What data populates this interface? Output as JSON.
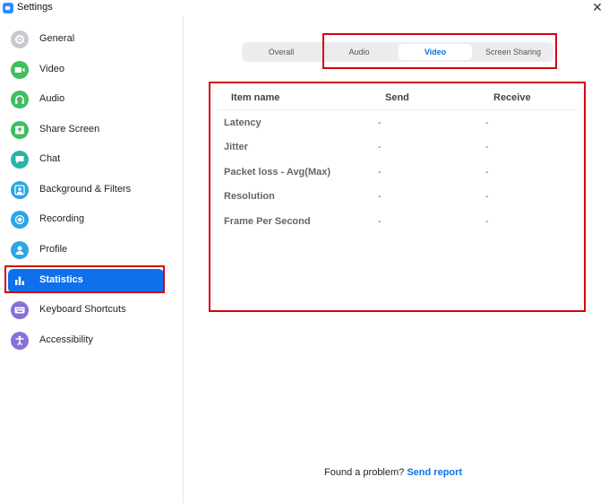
{
  "window": {
    "title": "Settings",
    "close_glyph": "✕"
  },
  "sidebar": {
    "items": [
      {
        "label": "General",
        "icon": "gear-icon",
        "color": "#c8c8d0"
      },
      {
        "label": "Video",
        "icon": "video-camera-icon",
        "color": "#3fbf5e"
      },
      {
        "label": "Audio",
        "icon": "headphones-icon",
        "color": "#3fbf5e"
      },
      {
        "label": "Share Screen",
        "icon": "share-screen-icon",
        "color": "#3fbf5e"
      },
      {
        "label": "Chat",
        "icon": "chat-bubble-icon",
        "color": "#2bb3a8"
      },
      {
        "label": "Background & Filters",
        "icon": "person-frame-icon",
        "color": "#2aa6e8"
      },
      {
        "label": "Recording",
        "icon": "record-icon",
        "color": "#2aa6e8"
      },
      {
        "label": "Profile",
        "icon": "profile-icon",
        "color": "#2aa6e8"
      },
      {
        "label": "Statistics",
        "icon": "bar-chart-icon",
        "color": "#0e71eb",
        "active": true
      },
      {
        "label": "Keyboard Shortcuts",
        "icon": "keyboard-icon",
        "color": "#8a6fd8"
      },
      {
        "label": "Accessibility",
        "icon": "accessibility-icon",
        "color": "#8a6fd8"
      }
    ]
  },
  "tabs": [
    {
      "label": "Overall"
    },
    {
      "label": "Audio"
    },
    {
      "label": "Video",
      "active": true
    },
    {
      "label": "Screen Sharing"
    }
  ],
  "stats_table": {
    "headers": {
      "item": "Item name",
      "send": "Send",
      "receive": "Receive"
    },
    "rows": [
      {
        "name": "Latency",
        "send": "-",
        "receive": "-"
      },
      {
        "name": "Jitter",
        "send": "-",
        "receive": "-"
      },
      {
        "name": "Packet loss - Avg(Max)",
        "send": "-",
        "receive": "-"
      },
      {
        "name": "Resolution",
        "send": "-",
        "receive": "-"
      },
      {
        "name": "Frame Per Second",
        "send": "-",
        "receive": "-"
      }
    ]
  },
  "footer": {
    "text": "Found a problem?",
    "link": "Send report"
  },
  "colors": {
    "accent": "#0e71eb",
    "highlight": "#d4000f"
  }
}
